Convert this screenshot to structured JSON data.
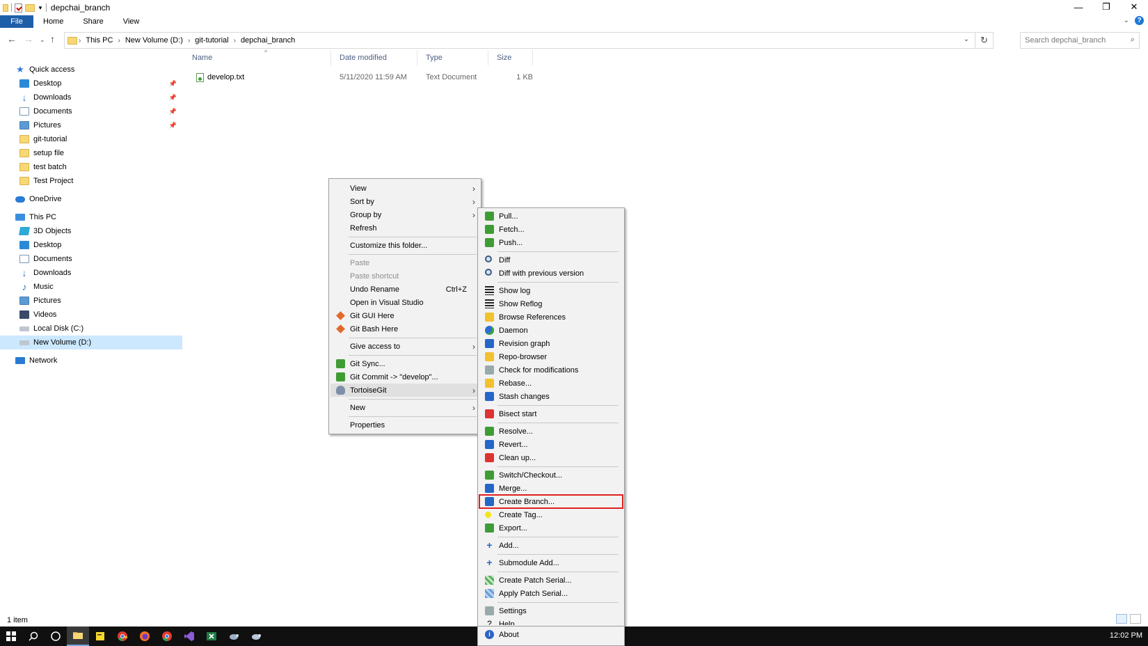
{
  "window": {
    "title": "depchai_branch"
  },
  "ribbon": {
    "tabs": [
      "File",
      "Home",
      "Share",
      "View"
    ]
  },
  "address": {
    "crumbs": [
      "This PC",
      "New Volume (D:)",
      "git-tutorial",
      "depchai_branch"
    ],
    "search_placeholder": "Search depchai_branch"
  },
  "nav": {
    "quick_access": "Quick access",
    "quick_items": [
      "Desktop",
      "Downloads",
      "Documents",
      "Pictures",
      "git-tutorial",
      "setup file",
      "test batch",
      "Test Project"
    ],
    "onedrive": "OneDrive",
    "this_pc": "This PC",
    "pc_items": [
      "3D Objects",
      "Desktop",
      "Documents",
      "Downloads",
      "Music",
      "Pictures",
      "Videos",
      "Local Disk (C:)",
      "New Volume (D:)"
    ],
    "network": "Network"
  },
  "columns": {
    "name": "Name",
    "date": "Date modified",
    "type": "Type",
    "size": "Size"
  },
  "files": [
    {
      "name": "develop.txt",
      "date": "5/11/2020 11:59 AM",
      "type": "Text Document",
      "size": "1 KB"
    }
  ],
  "status": {
    "count": "1 item"
  },
  "context_menu": {
    "items": {
      "view": "View",
      "sort_by": "Sort by",
      "group_by": "Group by",
      "refresh": "Refresh",
      "customize": "Customize this folder...",
      "paste": "Paste",
      "paste_shortcut": "Paste shortcut",
      "undo_rename": "Undo Rename",
      "undo_shortcut": "Ctrl+Z",
      "open_vs": "Open in Visual Studio",
      "git_gui": "Git GUI Here",
      "git_bash": "Git Bash Here",
      "give_access": "Give access to",
      "git_sync": "Git Sync...",
      "git_commit": "Git Commit -> \"develop\"...",
      "tortoisegit": "TortoiseGit",
      "new": "New",
      "properties": "Properties"
    }
  },
  "tortoise_menu": {
    "items": {
      "pull": "Pull...",
      "fetch": "Fetch...",
      "push": "Push...",
      "diff": "Diff",
      "diff_prev": "Diff with previous version",
      "show_log": "Show log",
      "show_reflog": "Show Reflog",
      "browse_refs": "Browse References",
      "daemon": "Daemon",
      "revision_graph": "Revision graph",
      "repo_browser": "Repo-browser",
      "check_mods": "Check for modifications",
      "rebase": "Rebase...",
      "stash": "Stash changes",
      "bisect": "Bisect start",
      "resolve": "Resolve...",
      "revert": "Revert...",
      "cleanup": "Clean up...",
      "switch": "Switch/Checkout...",
      "merge": "Merge...",
      "create_branch": "Create Branch...",
      "create_tag": "Create Tag...",
      "export": "Export...",
      "add": "Add...",
      "submodule_add": "Submodule Add...",
      "create_patch": "Create Patch Serial...",
      "apply_patch": "Apply Patch Serial...",
      "settings": "Settings",
      "help": "Help",
      "about": "About"
    },
    "highlight_color": "#e02020"
  },
  "taskbar": {
    "clock": "12:02 PM"
  }
}
